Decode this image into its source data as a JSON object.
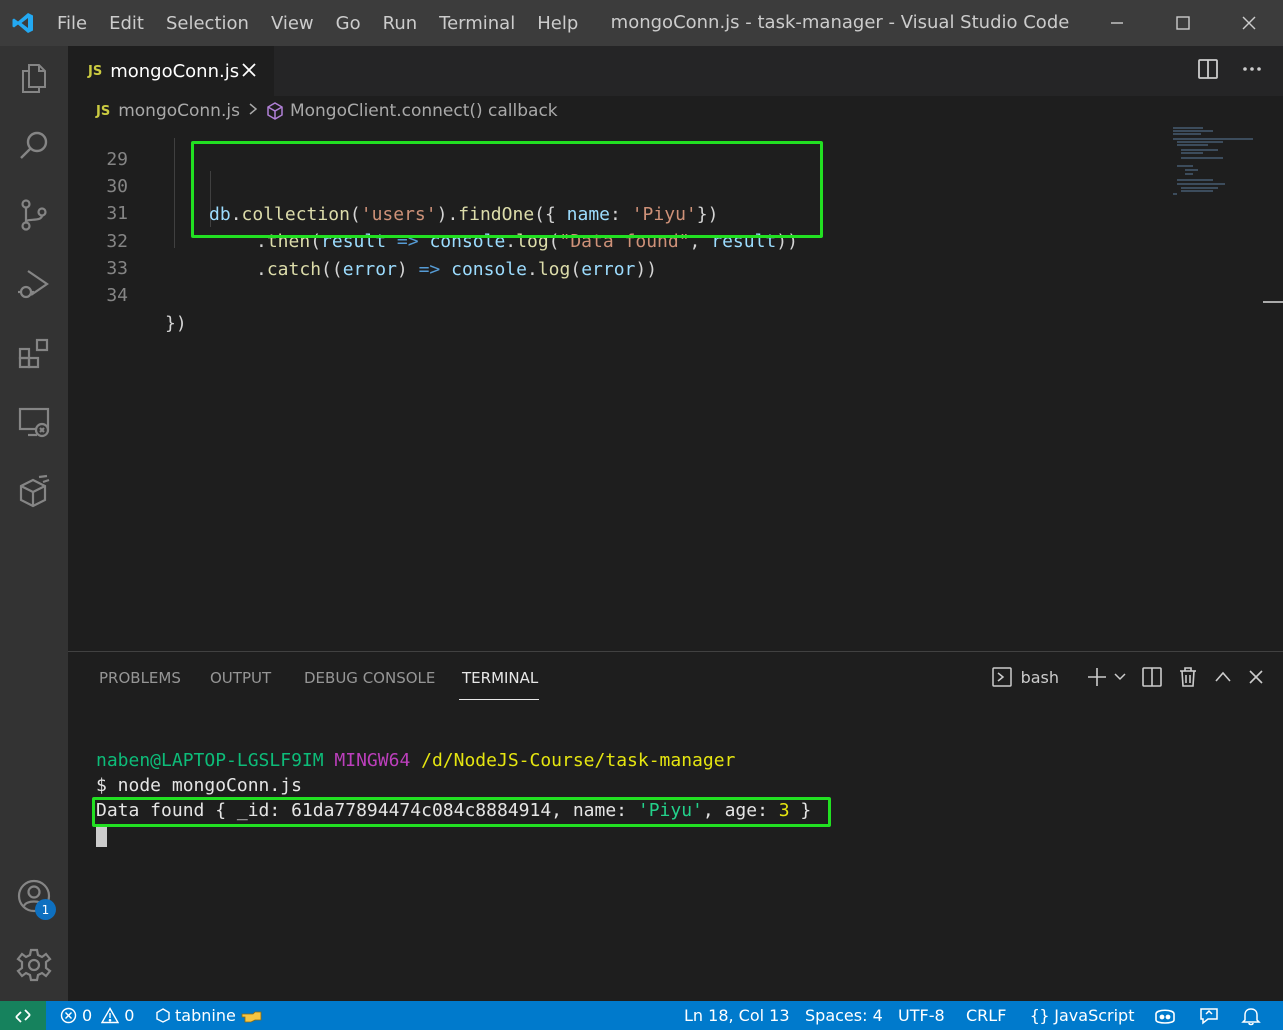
{
  "window": {
    "title": "mongoConn.js - task-manager - Visual Studio Code",
    "menu": [
      "File",
      "Edit",
      "Selection",
      "View",
      "Go",
      "Run",
      "Terminal",
      "Help"
    ]
  },
  "tab": {
    "lang_badge": "JS",
    "filename": "mongoConn.js"
  },
  "breadcrumb": {
    "file": "mongoConn.js",
    "symbol": "MongoClient.connect() callback"
  },
  "editor": {
    "line_numbers": [
      "29",
      "30",
      "31",
      "32",
      "33",
      "34"
    ],
    "lines": {
      "l30": {
        "db": "db",
        "p1": ".",
        "collection": "collection",
        "p2": "(",
        "s1": "'users'",
        "p3": ").",
        "findOne": "findOne",
        "p4": "({ ",
        "name": "name",
        "p5": ": ",
        "s2": "'Piyu'",
        "p6": "})"
      },
      "l31": {
        "p1": ".",
        "then": "then",
        "p2": "(",
        "result": "result",
        "arrow": " => ",
        "console": "console",
        "p3": ".",
        "log": "log",
        "p4": "(",
        "s1": "\"Data found\"",
        "p5": ", ",
        "result2": "result",
        "p6": "))"
      },
      "l32": {
        "p1": ".",
        "catch": "catch",
        "p2": "((",
        "error": "error",
        "p3": ") ",
        "arrow": "=>",
        "sp": " ",
        "console": "console",
        "p4": ".",
        "log": "log",
        "p5": "(",
        "error2": "error",
        "p6": "))"
      },
      "l34": {
        "text": "})"
      }
    }
  },
  "panel": {
    "tabs": [
      "PROBLEMS",
      "OUTPUT",
      "DEBUG CONSOLE",
      "TERMINAL"
    ],
    "shell": "bash",
    "terminal": {
      "user": "naben@LAPTOP-LGSLF9IM",
      "env": "MINGW64",
      "path": "/d/NodeJS-Course/task-manager",
      "command": "$ node mongoConn.js",
      "out_prefix": "Data found { _id: 61da77894474c084c8884914, name: ",
      "out_name": "'Piyu'",
      "out_mid": ", age: ",
      "out_age": "3",
      "out_end": " }"
    }
  },
  "activity": {
    "accounts_badge": "1"
  },
  "statusbar": {
    "errors": "0",
    "warnings": "0",
    "tabnine": "tabnine",
    "position": "Ln 18, Col 13",
    "spaces": "Spaces: 4",
    "encoding": "UTF-8",
    "eol": "CRLF",
    "language": "JavaScript"
  },
  "colors": {
    "highlight_box": "#22e022",
    "statusbar": "#007acc",
    "remote": "#16825d"
  }
}
